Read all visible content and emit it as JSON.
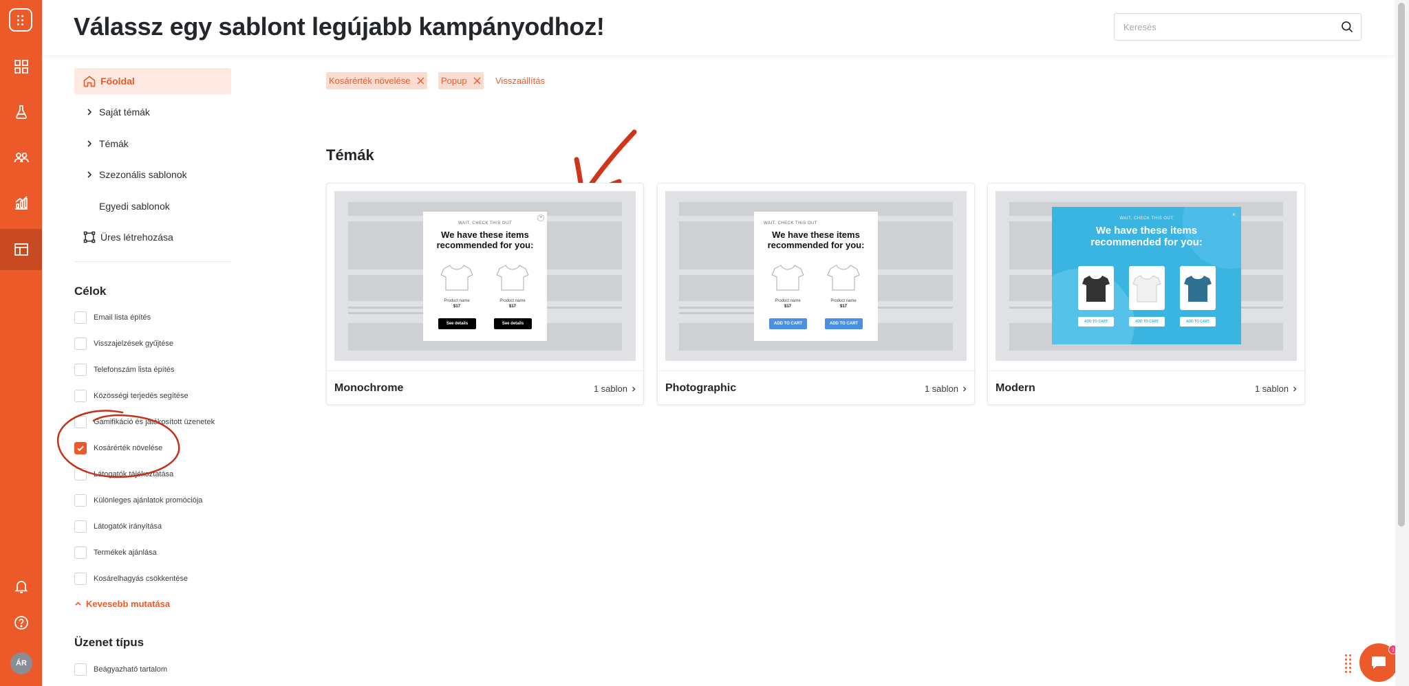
{
  "header": {
    "title": "Válassz egy sablont legújabb kampányodhoz!",
    "search_placeholder": "Keresés"
  },
  "rail": {
    "avatar_initials": "ÁR",
    "items": [
      "dashboard-icon",
      "flask-icon",
      "users-icon",
      "analytics-icon",
      "templates-icon",
      "bell-icon",
      "help-icon"
    ]
  },
  "sidebar": {
    "nav": [
      {
        "label": "Főoldal",
        "icon": "home-icon",
        "active": true
      },
      {
        "label": "Saját témák",
        "icon": "chevron-right-icon"
      },
      {
        "label": "Témák",
        "icon": "chevron-right-icon"
      },
      {
        "label": "Szezonális sablonok",
        "icon": "chevron-right-icon"
      },
      {
        "label": "Egyedi sablonok"
      },
      {
        "label": "Üres létrehozása",
        "icon": "frame-icon"
      }
    ],
    "goals_title": "Célok",
    "goals": [
      {
        "label": "Email lista építés",
        "checked": false
      },
      {
        "label": "Visszajelzések gyűjtése",
        "checked": false
      },
      {
        "label": "Telefonszám lista építés",
        "checked": false
      },
      {
        "label": "Közösségi terjedés segítése",
        "checked": false
      },
      {
        "label": "Gamifikáció és játékosított üzenetek",
        "checked": false
      },
      {
        "label": "Kosárérték növelése",
        "checked": true
      },
      {
        "label": "Látogatók tájékoztatása",
        "checked": false
      },
      {
        "label": "Különleges ajánlatok promóciója",
        "checked": false
      },
      {
        "label": "Látogatók irányítása",
        "checked": false
      },
      {
        "label": "Termékek ajánlása",
        "checked": false
      },
      {
        "label": "Kosárelhagyás csökkentése",
        "checked": false
      }
    ],
    "show_less": "Kevesebb mutatása",
    "message_type_title": "Üzenet típus",
    "message_types": [
      {
        "label": "Beágyazható tartalom",
        "checked": false
      }
    ]
  },
  "filters": {
    "chips": [
      "Kosárérték növelése",
      "Popup"
    ],
    "reset": "Visszaállítás"
  },
  "themes": {
    "title": "Témák",
    "cards": [
      {
        "name": "Monochrome",
        "count": "1 sablon"
      },
      {
        "name": "Photographic",
        "count": "1 sablon"
      },
      {
        "name": "Modern",
        "count": "1 sablon"
      }
    ]
  },
  "previews": {
    "pre": "WAIT, CHECK THIS OUT",
    "headline": "We have these items recommended for you:",
    "product_name": "Product name",
    "product_price": "$17",
    "btn_details": "See details",
    "btn_cart": "ADD TO CART"
  },
  "chat": {
    "badge": "1"
  },
  "colors": {
    "brand": "#ed5a29",
    "rail_active": "#c94a20",
    "chip_bg": "#fcdcd0",
    "modern_bg": "#3ab5e2",
    "photo_btn": "#4b8fe0"
  }
}
